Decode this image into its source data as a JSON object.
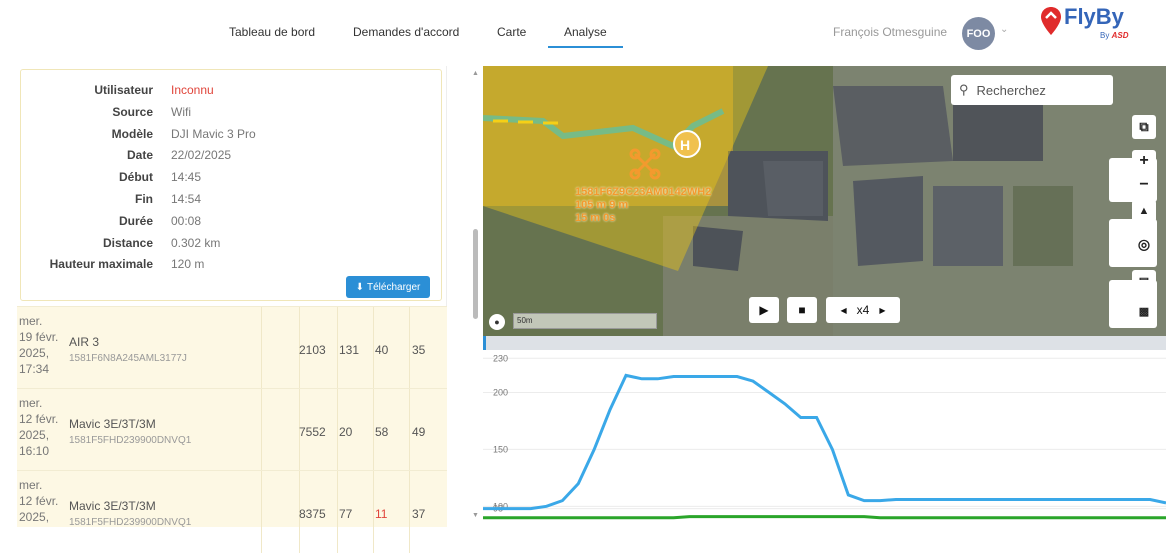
{
  "nav": {
    "items": [
      "Tableau de bord",
      "Demandes d'accord",
      "Carte",
      "Analyse"
    ],
    "active": "Analyse"
  },
  "user": {
    "name": "François Otmesguine",
    "initials": "FOO"
  },
  "brand": {
    "name": "FlyBy",
    "by": "By",
    "company": "ASD"
  },
  "details": {
    "rows": [
      {
        "label": "Utilisateur",
        "value": "Inconnu"
      },
      {
        "label": "Source",
        "value": "Wifi"
      },
      {
        "label": "Modèle",
        "value": "DJI Mavic 3 Pro"
      },
      {
        "label": "Date",
        "value": "22/02/2025"
      },
      {
        "label": "Début",
        "value": "14:45"
      },
      {
        "label": "Fin",
        "value": "14:54"
      },
      {
        "label": "Durée",
        "value": "00:08"
      },
      {
        "label": "Distance",
        "value": "0.302 km"
      },
      {
        "label": "Hauteur maximale",
        "value": "120 m"
      }
    ],
    "download_label": "Télécharger"
  },
  "flights": [
    {
      "date_lines": [
        "mer.",
        "19 févr.",
        "2025,",
        "17:34"
      ],
      "model": "AIR 3",
      "serial": "1581F6N8A245AML3177J",
      "values": [
        "2103",
        "131",
        "40",
        "35"
      ]
    },
    {
      "date_lines": [
        "mer.",
        "12 févr.",
        "2025,",
        "16:10"
      ],
      "model": "Mavic 3E/3T/3M",
      "serial": "1581F5FHD239900DNVQ1",
      "values": [
        "7552",
        "20",
        "58",
        "49"
      ]
    },
    {
      "date_lines": [
        "mer.",
        "12 févr.",
        "2025,"
      ],
      "model": "Mavic 3E/3T/3M",
      "serial": "1581F5FHD239900DNVQ1",
      "values": [
        "8375",
        "77",
        "11",
        "37"
      ]
    }
  ],
  "map": {
    "search_placeholder": "Recherchez",
    "drone_label": [
      "1581F6Z9C23AM0142WH2",
      "105 m 9 m",
      "15 m 0s"
    ],
    "scale_label": "50m",
    "speed_label": "x4",
    "home_label": "H"
  },
  "chart_data": {
    "type": "line",
    "yticks": [
      "230",
      "200",
      "150",
      "100",
      "98"
    ],
    "series": [
      {
        "color": "#3aa8e8",
        "values": [
          98,
          98,
          98,
          98,
          100,
          105,
          120,
          150,
          185,
          215,
          212,
          212,
          214,
          214,
          214,
          214,
          214,
          210,
          200,
          190,
          178,
          178,
          150,
          110,
          105,
          105,
          106,
          106,
          106,
          106,
          106,
          106,
          106,
          106,
          106,
          106,
          106,
          106,
          106,
          106,
          106,
          106,
          106,
          103
        ]
      },
      {
        "color": "#2aa52a",
        "values": [
          90,
          90,
          90,
          90,
          90,
          90,
          90,
          90,
          90,
          90,
          90,
          90,
          90,
          91,
          91,
          91,
          91,
          91,
          91,
          91,
          91,
          91,
          91,
          91,
          91,
          90,
          90,
          90,
          90,
          90,
          90,
          90,
          90,
          90,
          90,
          90,
          90,
          90,
          90,
          90,
          90,
          90,
          90,
          90
        ]
      }
    ],
    "ylim": [
      88,
      232
    ]
  }
}
